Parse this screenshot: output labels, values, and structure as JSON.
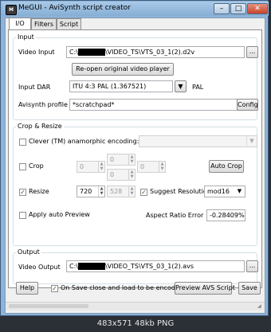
{
  "window": {
    "title": "MeGUI - AviSynth script creator",
    "app_icon": "MeGUI"
  },
  "tabs": [
    {
      "label": "I/O"
    },
    {
      "label": "Filters"
    },
    {
      "label": "Script"
    }
  ],
  "input": {
    "group_label": "Input",
    "video_input_label": "Video Input",
    "video_input_prefix": "C:\\",
    "video_input_suffix": "\\VIDEO_TS\\VTS_03_1(2).d2v",
    "browse_label": "...",
    "reopen_button": "Re-open original video player",
    "dar_label": "Input DAR",
    "dar_value": "ITU 4:3 PAL (1.367521)",
    "dar_suffix": "PAL",
    "profile_label": "Avisynth profile",
    "profile_value": "*scratchpad*",
    "config_button": "Config"
  },
  "crop": {
    "group_label": "Crop & Resize",
    "clever_label": "Clever (TM) anamorphic encoding:",
    "clever_value": "",
    "crop_label": "Crop",
    "crop_values": [
      "0",
      "0",
      "0",
      "0"
    ],
    "auto_crop_button": "Auto Crop",
    "resize_label": "Resize",
    "resize_checked": true,
    "width_value": "720",
    "height_value": "528",
    "suggest_label": "Suggest Resolution",
    "suggest_checked": true,
    "mod_value": "mod16",
    "auto_preview_label": "Apply auto Preview",
    "ar_error_label": "Aspect Ratio Error",
    "ar_error_value": "-0.28409%"
  },
  "output": {
    "group_label": "Output",
    "video_output_label": "Video Output",
    "video_output_prefix": "C:\\",
    "video_output_suffix": "\\VIDEO_TS\\VTS_03_1(2).avs",
    "browse_label": "..."
  },
  "bottom": {
    "help_button": "Help",
    "save_close_label": "On Save close and load to be encoded",
    "save_close_checked": true,
    "preview_button": "Preview AVS Script",
    "save_button": "Save"
  },
  "caption": "483x571 48kb PNG"
}
